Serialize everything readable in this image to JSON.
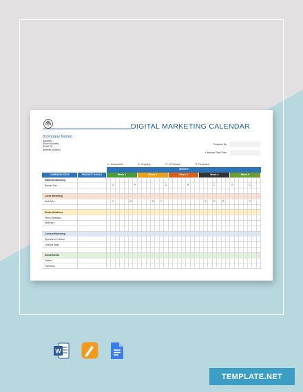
{
  "colors": {
    "background_top": "#e2e0e0",
    "background_bottom": "#b7d8df",
    "title_blue": "#1c5aa0",
    "header_blue": "#2e73b8",
    "week_colors": [
      "#4c9a3c",
      "#e8a21a",
      "#d8611e",
      "#333333",
      "#6e9e32"
    ],
    "category_colors": {
      "national": "#ffffff",
      "local": "#fbe0cf",
      "public": "#fff0c2",
      "content": "#dde8f6",
      "social": "#e2efd9"
    }
  },
  "document": {
    "title": "DIGITAL MARKETING CALENDAR",
    "logo_icon": "seal-logo-icon",
    "company": {
      "name": "[Company Name]",
      "address": "[Address]",
      "phone": "[Phone Number]",
      "email": "[Email ID]",
      "website": "[Website Address]"
    },
    "prepared_by_label": "Prepared By:",
    "start_date_label": "Calendar Start Date:",
    "legend": [
      "C: Completed",
      "O: Ongoing",
      "P: In Process",
      "R: Repeated"
    ],
    "month_label": "MONTH",
    "col_campaign": "CAMPAIGN TITLE",
    "col_goals": "PROJECT GOALS",
    "weeks": [
      "Week 1",
      "Week 2",
      "Week 3",
      "Week 4",
      "Week 5"
    ],
    "rows": [
      {
        "label": "National Marketing",
        "type": "cat",
        "color": "national",
        "marks": {}
      },
      {
        "label": "Banner Ads",
        "type": "item",
        "color": "national",
        "marks": {
          "1": "C",
          "6": "P",
          "13": "C",
          "18": "R",
          "24": "C",
          "28": "O",
          "32": "C"
        }
      },
      {
        "label": "",
        "type": "blank",
        "color": "national",
        "marks": {}
      },
      {
        "label": "Local Marketing",
        "type": "cat",
        "color": "local",
        "marks": {}
      },
      {
        "label": "Web ADs",
        "type": "item",
        "color": "local",
        "marks": {
          "1": "C",
          "5": "O",
          "10": "R",
          "12": "C",
          "22": "P",
          "24": "R",
          "26": "O",
          "32": "C"
        }
      },
      {
        "label": "",
        "type": "blank",
        "color": "local",
        "marks": {}
      },
      {
        "label": "Public Relations",
        "type": "cat",
        "color": "public",
        "marks": {}
      },
      {
        "label": "Press Releases",
        "type": "item",
        "color": "public",
        "marks": {}
      },
      {
        "label": "Webinars",
        "type": "item",
        "color": "public",
        "marks": {}
      },
      {
        "label": "",
        "type": "blank",
        "color": "public",
        "marks": {}
      },
      {
        "label": "Content Marketing",
        "type": "cat",
        "color": "content",
        "marks": {}
      },
      {
        "label": "Sponsored Content",
        "type": "item",
        "color": "content",
        "marks": {}
      },
      {
        "label": "Landing page",
        "type": "item",
        "color": "content",
        "marks": {}
      },
      {
        "label": "",
        "type": "blank",
        "color": "content",
        "marks": {}
      },
      {
        "label": "Social Media",
        "type": "cat",
        "color": "social",
        "marks": {}
      },
      {
        "label": "Twitter",
        "type": "item",
        "color": "social",
        "marks": {}
      },
      {
        "label": "Facebook",
        "type": "item",
        "color": "social",
        "marks": {}
      }
    ]
  },
  "formats": {
    "word_icon": "word-doc-icon",
    "pages_icon": "pages-doc-icon",
    "gdocs_icon": "google-docs-icon"
  },
  "brand": {
    "label": "TEMPLATE.NET"
  }
}
